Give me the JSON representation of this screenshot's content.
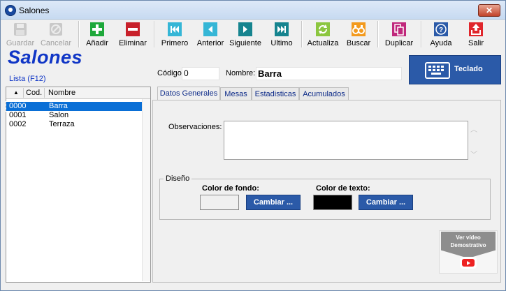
{
  "window": {
    "title": "Salones",
    "close_glyph": "✕"
  },
  "toolbar": [
    {
      "label": "Guardar",
      "icon": "save-icon",
      "disabled": true
    },
    {
      "label": "Cancelar",
      "icon": "cancel-icon",
      "disabled": true
    },
    {
      "label": "Añadir",
      "icon": "add-icon",
      "disabled": false
    },
    {
      "label": "Eliminar",
      "icon": "delete-icon",
      "disabled": false
    },
    {
      "label": "Primero",
      "icon": "first-icon",
      "disabled": false
    },
    {
      "label": "Anterior",
      "icon": "previous-icon",
      "disabled": false
    },
    {
      "label": "Siguiente",
      "icon": "next-icon",
      "disabled": false
    },
    {
      "label": "Ultimo",
      "icon": "last-icon",
      "disabled": false
    },
    {
      "label": "Actualiza",
      "icon": "refresh-icon",
      "disabled": false
    },
    {
      "label": "Buscar",
      "icon": "binoculars-icon",
      "disabled": false
    },
    {
      "label": "Duplicar",
      "icon": "duplicate-icon",
      "disabled": false
    },
    {
      "label": "Ayuda",
      "icon": "help-icon",
      "disabled": false
    },
    {
      "label": "Salir",
      "icon": "exit-icon",
      "disabled": false
    }
  ],
  "heading": "Salones",
  "lista_label": "Lista (F12)",
  "form": {
    "codigo_label": "Código:",
    "codigo_value": "0",
    "nombre_label": "Nombre:",
    "nombre_value": "Barra"
  },
  "teclado_label": "Teclado",
  "list": {
    "sort_glyph": "▲",
    "columns": [
      "Cod.",
      "Nombre"
    ],
    "rows": [
      {
        "cod": "0000",
        "nombre": "Barra",
        "selected": true
      },
      {
        "cod": "0001",
        "nombre": "Salon",
        "selected": false
      },
      {
        "cod": "0002",
        "nombre": "Terraza",
        "selected": false
      }
    ]
  },
  "tabs": [
    {
      "label": "Datos Generales",
      "active": true
    },
    {
      "label": "Mesas",
      "active": false
    },
    {
      "label": "Estadisticas",
      "active": false
    },
    {
      "label": "Acumulados",
      "active": false
    }
  ],
  "datos_generales": {
    "observaciones_label": "Observaciones:",
    "observaciones_value": "",
    "diseno_label": "Diseño",
    "color_fondo_label": "Color de fondo:",
    "color_fondo_value": "#f0f0f0",
    "color_texto_label": "Color de texto:",
    "color_texto_value": "#000000",
    "cambiar_label": "Cambiar ..."
  },
  "video": {
    "line1": "Ver vídeo",
    "line2": "Demostrativo"
  },
  "colors": {
    "accent": "#2b5aa8",
    "heading": "#1036c6",
    "selection": "#0a6fd6"
  }
}
